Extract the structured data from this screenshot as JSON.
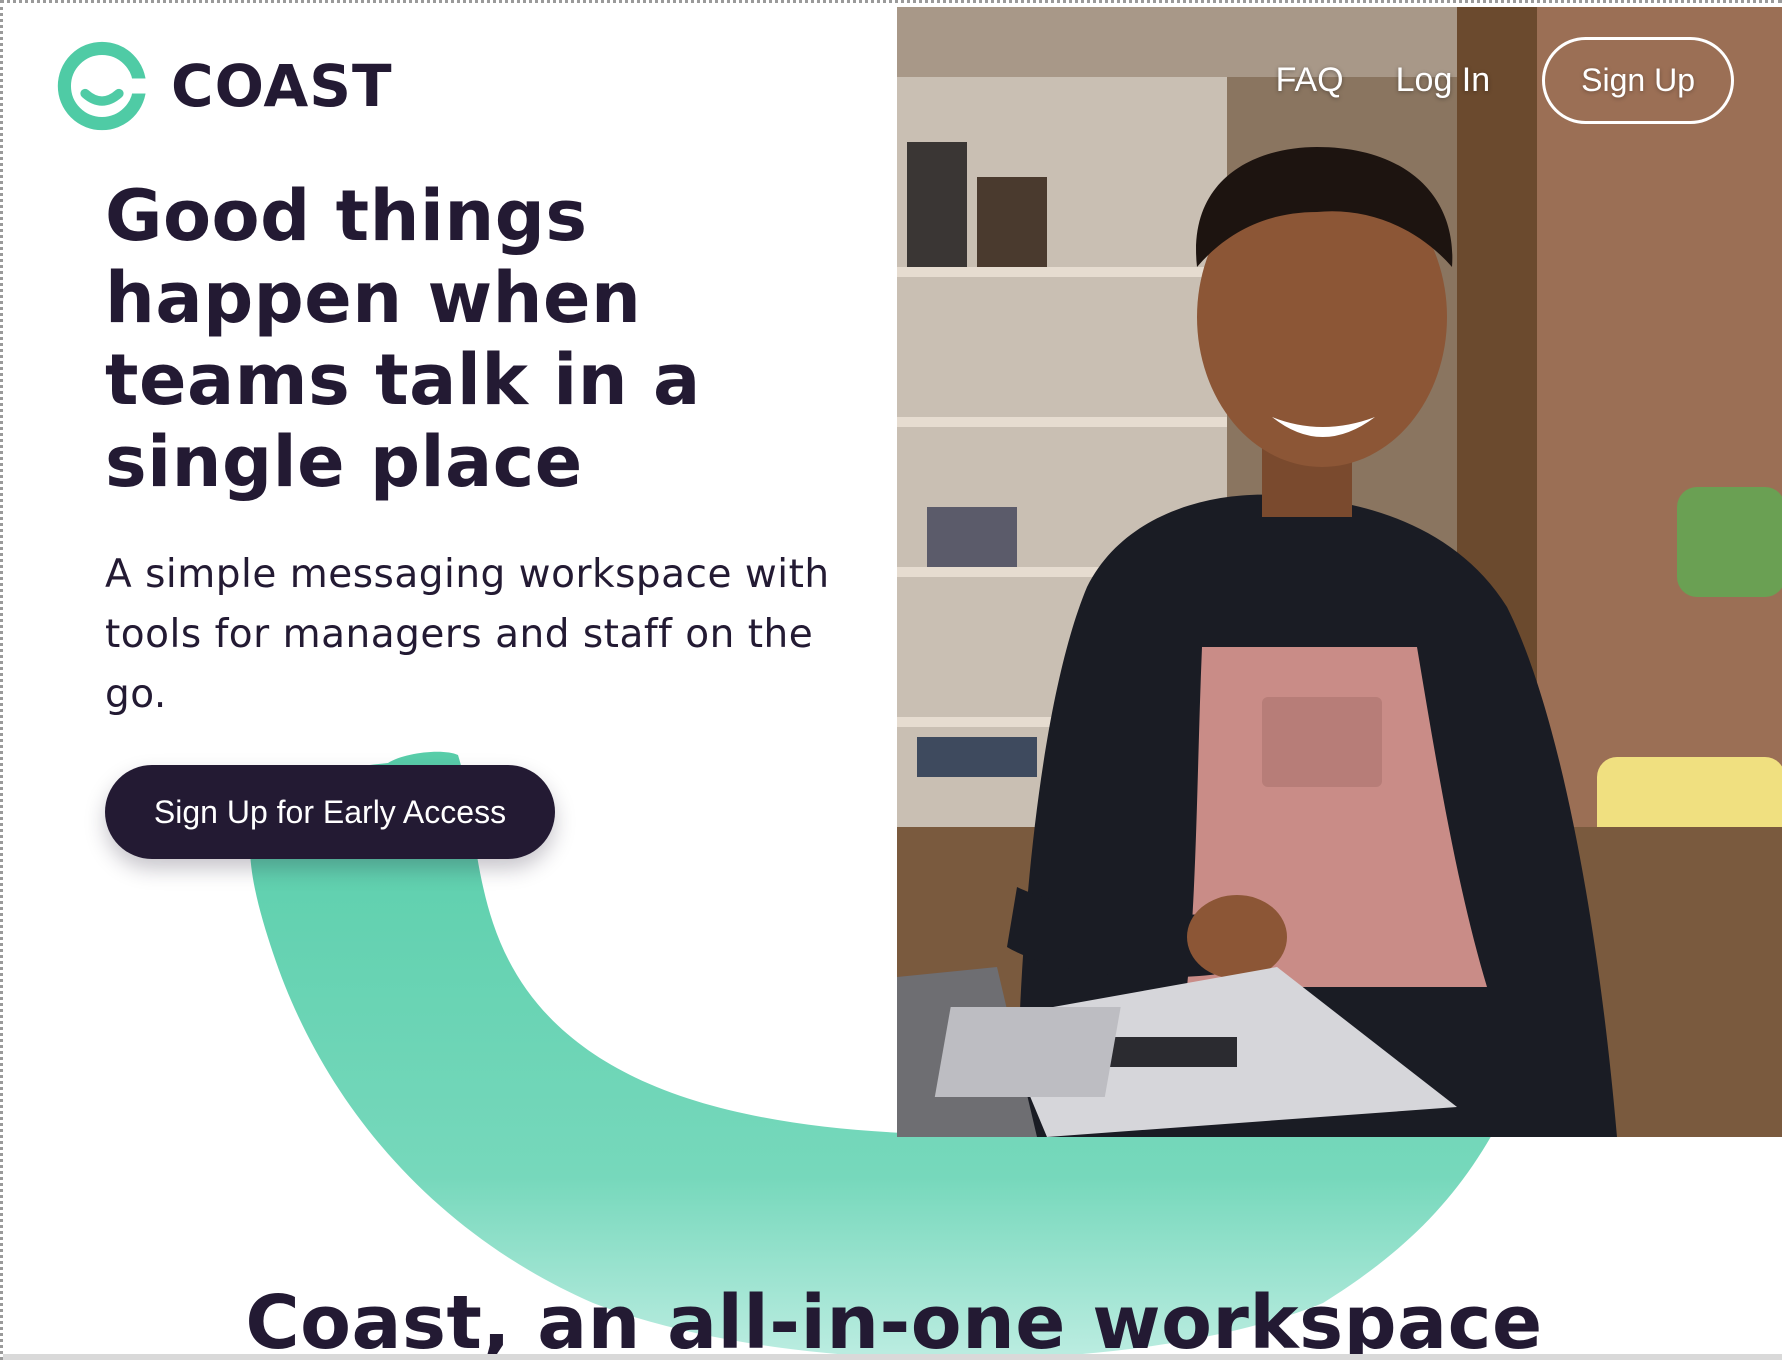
{
  "brand": {
    "name": "COAST",
    "accent_color": "#4fcba5",
    "dark_color": "#231a33"
  },
  "nav": {
    "faq": "FAQ",
    "login": "Log In",
    "signup": "Sign Up"
  },
  "hero": {
    "headline": "Good things happen when teams talk in a single place",
    "subhead": "A simple messaging workspace with tools for managers and staff on the go.",
    "cta": "Sign Up for Early Access",
    "photo_description": "smiling-barista-at-laptop-photo"
  },
  "section": {
    "title": "Coast, an all-in-one workspace"
  }
}
